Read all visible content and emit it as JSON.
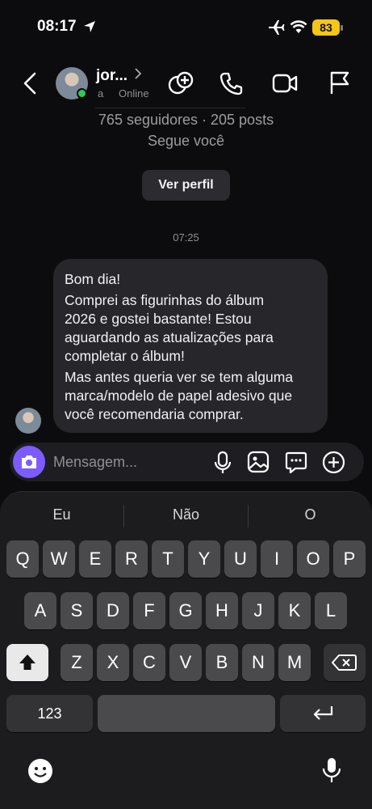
{
  "status_bar": {
    "time": "08:17",
    "battery": "83"
  },
  "header": {
    "contact_name": "jor...",
    "contact_sub": "a",
    "contact_status": "Online"
  },
  "profile": {
    "stats": "765 seguidores · 205 posts",
    "follows_you": "Segue você",
    "view_profile_label": "Ver perfil"
  },
  "conversation": {
    "timestamp": "07:25",
    "message_paragraphs": [
      "Bom dia!",
      "Comprei as figurinhas do álbum\n2026 e gostei bastante! Estou\naguardando as atualizações para\ncompletar o álbum!",
      "Mas antes queria ver se tem alguma\nmarca/modelo de papel adesivo que\nvocê recomendaria comprar."
    ]
  },
  "composer": {
    "placeholder": "Mensagem..."
  },
  "keyboard": {
    "suggestions": [
      "Eu",
      "Não",
      "O"
    ],
    "row1": [
      "Q",
      "W",
      "E",
      "R",
      "T",
      "Y",
      "U",
      "I",
      "O",
      "P"
    ],
    "row2": [
      "A",
      "S",
      "D",
      "F",
      "G",
      "H",
      "J",
      "K",
      "L"
    ],
    "row3": [
      "Z",
      "X",
      "C",
      "V",
      "B",
      "N",
      "M"
    ],
    "numbers_label": "123"
  }
}
